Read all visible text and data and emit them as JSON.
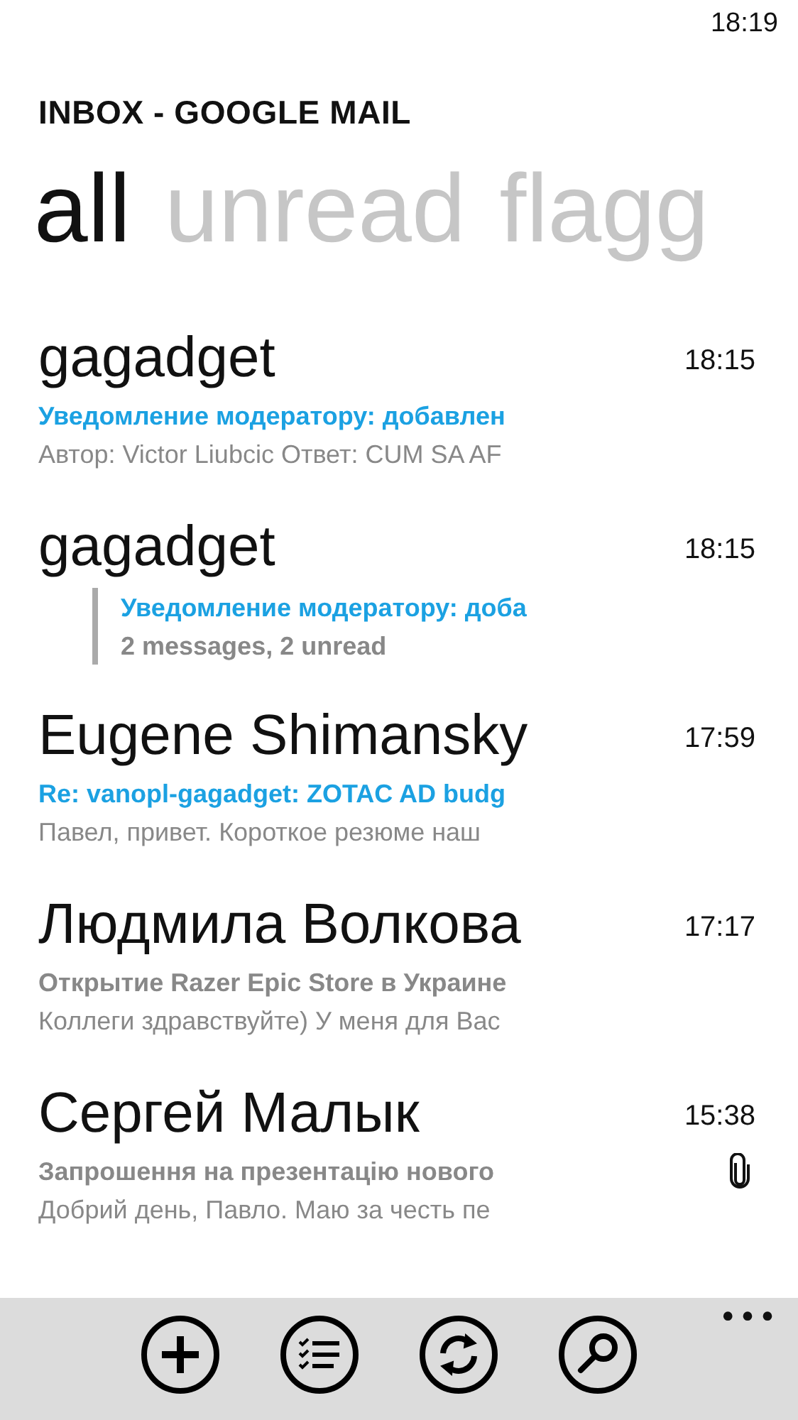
{
  "status_bar": {
    "time": "18:19"
  },
  "title": "INBOX - GOOGLE MAIL",
  "pivots": [
    {
      "label": "all",
      "selected": true
    },
    {
      "label": "unread",
      "selected": false
    },
    {
      "label": "flagg",
      "selected": false
    }
  ],
  "messages": [
    {
      "kind": "message",
      "sender": "gagadget",
      "time": "18:15",
      "subject": "Уведомление модератору: добавлен",
      "preview": "Автор: Victor Liubcic Ответ: CUM SA AF",
      "unread": true,
      "attachment": false
    },
    {
      "kind": "thread",
      "sender": "gagadget",
      "time": "18:15",
      "subject": "Уведомление модератору: доба",
      "preview": "2 messages, 2 unread",
      "unread": true,
      "attachment": false
    },
    {
      "kind": "message",
      "sender": "Eugene Shimansky",
      "time": "17:59",
      "subject": "Re: vanopl-gagadget: ZOTAC AD budg",
      "preview": "Павел, привет. Короткое резюме наш",
      "unread": true,
      "attachment": false
    },
    {
      "kind": "message",
      "sender": "Людмила Волкова",
      "time": "17:17",
      "subject": "Открытие Razer Epic Store в Украине",
      "preview": "Коллеги здравствуйте) У меня для Вас",
      "unread": false,
      "attachment": false
    },
    {
      "kind": "message",
      "sender": "Сергей Малык",
      "time": "15:38",
      "subject": "Запрошення на презентацію нового",
      "preview": "Добрий день, Павло. Маю за честь пе",
      "unread": false,
      "attachment": true
    }
  ],
  "app_bar": {
    "buttons": [
      {
        "kind": "new"
      },
      {
        "kind": "select"
      },
      {
        "kind": "sync"
      },
      {
        "kind": "search"
      }
    ],
    "more": "•••"
  }
}
